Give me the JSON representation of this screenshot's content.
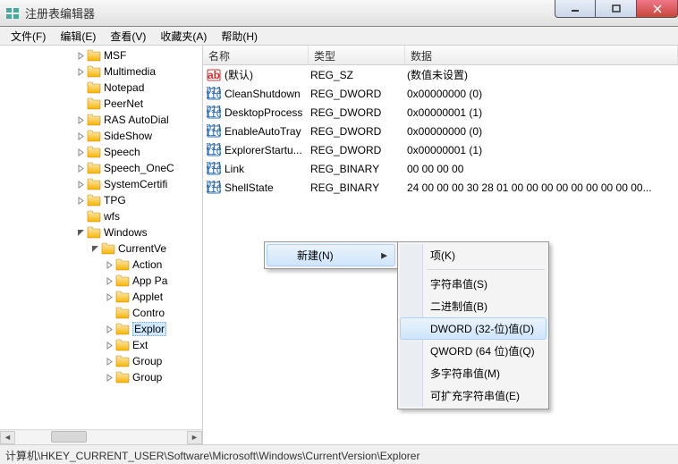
{
  "window": {
    "title": "注册表编辑器"
  },
  "menubar": {
    "file": "文件(F)",
    "edit": "编辑(E)",
    "view": "查看(V)",
    "favorites": "收藏夹(A)",
    "help": "帮助(H)"
  },
  "tree": {
    "items": [
      {
        "indent": 84,
        "toggle": "closed",
        "label": "MSF"
      },
      {
        "indent": 84,
        "toggle": "closed",
        "label": "Multimedia"
      },
      {
        "indent": 84,
        "toggle": "none",
        "label": "Notepad"
      },
      {
        "indent": 84,
        "toggle": "none",
        "label": "PeerNet"
      },
      {
        "indent": 84,
        "toggle": "closed",
        "label": "RAS AutoDial"
      },
      {
        "indent": 84,
        "toggle": "closed",
        "label": "SideShow"
      },
      {
        "indent": 84,
        "toggle": "closed",
        "label": "Speech"
      },
      {
        "indent": 84,
        "toggle": "closed",
        "label": "Speech_OneC"
      },
      {
        "indent": 84,
        "toggle": "closed",
        "label": "SystemCertifi"
      },
      {
        "indent": 84,
        "toggle": "closed",
        "label": "TPG"
      },
      {
        "indent": 84,
        "toggle": "none",
        "label": "wfs"
      },
      {
        "indent": 84,
        "toggle": "open",
        "label": "Windows"
      },
      {
        "indent": 100,
        "toggle": "open",
        "label": "CurrentVe"
      },
      {
        "indent": 116,
        "toggle": "closed",
        "label": "Action"
      },
      {
        "indent": 116,
        "toggle": "closed",
        "label": "App Pa"
      },
      {
        "indent": 116,
        "toggle": "closed",
        "label": "Applet"
      },
      {
        "indent": 116,
        "toggle": "none",
        "label": "Contro"
      },
      {
        "indent": 116,
        "toggle": "closed",
        "label": "Explor",
        "selected": true
      },
      {
        "indent": 116,
        "toggle": "closed",
        "label": "Ext"
      },
      {
        "indent": 116,
        "toggle": "closed",
        "label": "Group"
      },
      {
        "indent": 116,
        "toggle": "closed",
        "label": "Group"
      }
    ]
  },
  "columns": {
    "name": "名称",
    "type": "类型",
    "data": "数据"
  },
  "values": [
    {
      "icon": "string",
      "name": "(默认)",
      "type": "REG_SZ",
      "data": "(数值未设置)"
    },
    {
      "icon": "binary",
      "name": "CleanShutdown",
      "type": "REG_DWORD",
      "data": "0x00000000 (0)"
    },
    {
      "icon": "binary",
      "name": "DesktopProcess",
      "type": "REG_DWORD",
      "data": "0x00000001 (1)"
    },
    {
      "icon": "binary",
      "name": "EnableAutoTray",
      "type": "REG_DWORD",
      "data": "0x00000000 (0)"
    },
    {
      "icon": "binary",
      "name": "ExplorerStartu...",
      "type": "REG_DWORD",
      "data": "0x00000001 (1)"
    },
    {
      "icon": "binary",
      "name": "Link",
      "type": "REG_BINARY",
      "data": "00 00 00 00"
    },
    {
      "icon": "binary",
      "name": "ShellState",
      "type": "REG_BINARY",
      "data": "24 00 00 00 30 28 01 00 00 00 00 00 00 00 00 00..."
    }
  ],
  "context": {
    "new": "新建(N)",
    "sub": {
      "key": "项(K)",
      "string": "字符串值(S)",
      "binary": "二进制值(B)",
      "dword": "DWORD (32-位)值(D)",
      "qword": "QWORD (64 位)值(Q)",
      "multi": "多字符串值(M)",
      "expand": "可扩充字符串值(E)"
    }
  },
  "statusbar": {
    "path": "计算机\\HKEY_CURRENT_USER\\Software\\Microsoft\\Windows\\CurrentVersion\\Explorer"
  }
}
